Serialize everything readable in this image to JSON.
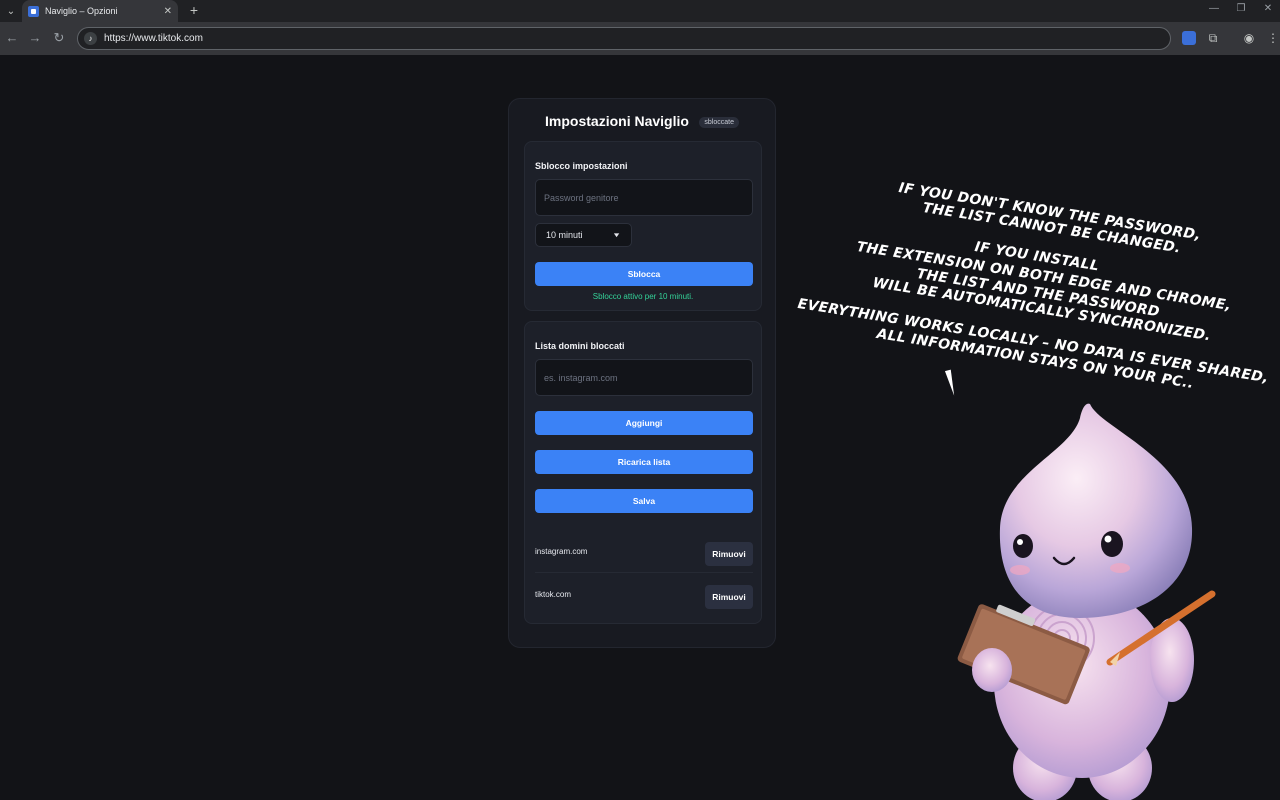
{
  "browser": {
    "tab_title": "Naviglio – Opzioni",
    "url": "https://www.tiktok.com"
  },
  "options": {
    "title": "Impostazioni Naviglio",
    "badge": "sbloccate",
    "unlock_section": {
      "title": "Sblocco impostazioni",
      "password_placeholder": "Password genitore",
      "duration_selected": "10 minuti",
      "unlock_button": "Sblocca",
      "status": "Sblocco attivo per 10 minuti."
    },
    "blocklist_section": {
      "title": "Lista domini bloccati",
      "domain_placeholder": "es. instagram.com",
      "add_button": "Aggiungi",
      "reload_button": "Ricarica lista",
      "save_button": "Salva",
      "remove_label": "Rimuovi",
      "domains": [
        "instagram.com",
        "tiktok.com"
      ]
    }
  },
  "caption": {
    "lines": [
      "If you don't know the password,",
      "the list cannot be changed.",
      "If you install",
      "the extension on both Edge and Chrome,",
      "the list and the password",
      "will be automatically synchronized.",
      "Everything works locally – no data is ever shared,",
      "all information stays on your PC.."
    ]
  },
  "colors": {
    "accent": "#3b82f6",
    "status_green": "#34d399",
    "page_bg": "#121317"
  }
}
